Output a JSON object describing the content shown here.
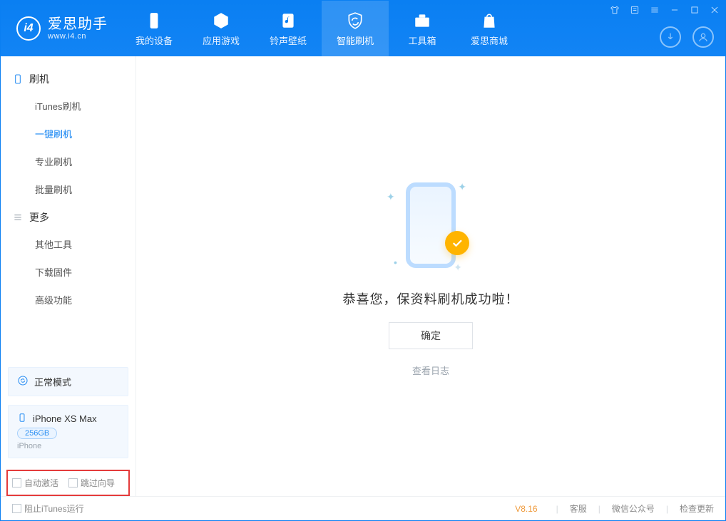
{
  "app": {
    "title": "爱思助手",
    "subtitle": "www.i4.cn"
  },
  "nav": {
    "items": [
      {
        "label": "我的设备"
      },
      {
        "label": "应用游戏"
      },
      {
        "label": "铃声壁纸"
      },
      {
        "label": "智能刷机"
      },
      {
        "label": "工具箱"
      },
      {
        "label": "爱思商城"
      }
    ],
    "active_index": 3
  },
  "sidebar": {
    "sections": [
      {
        "title": "刷机",
        "items": [
          "iTunes刷机",
          "一键刷机",
          "专业刷机",
          "批量刷机"
        ],
        "active_index": 1
      },
      {
        "title": "更多",
        "items": [
          "其他工具",
          "下载固件",
          "高级功能"
        ]
      }
    ],
    "mode": {
      "label": "正常模式"
    },
    "device": {
      "name": "iPhone XS Max",
      "capacity": "256GB",
      "type": "iPhone"
    },
    "options": {
      "auto_activate": "自动激活",
      "skip_wizard": "跳过向导"
    }
  },
  "main": {
    "title": "恭喜您，保资料刷机成功啦！",
    "ok": "确定",
    "view_log": "查看日志"
  },
  "footer": {
    "block_itunes": "阻止iTunes运行",
    "version": "V8.16",
    "links": [
      "客服",
      "微信公众号",
      "检查更新"
    ]
  }
}
